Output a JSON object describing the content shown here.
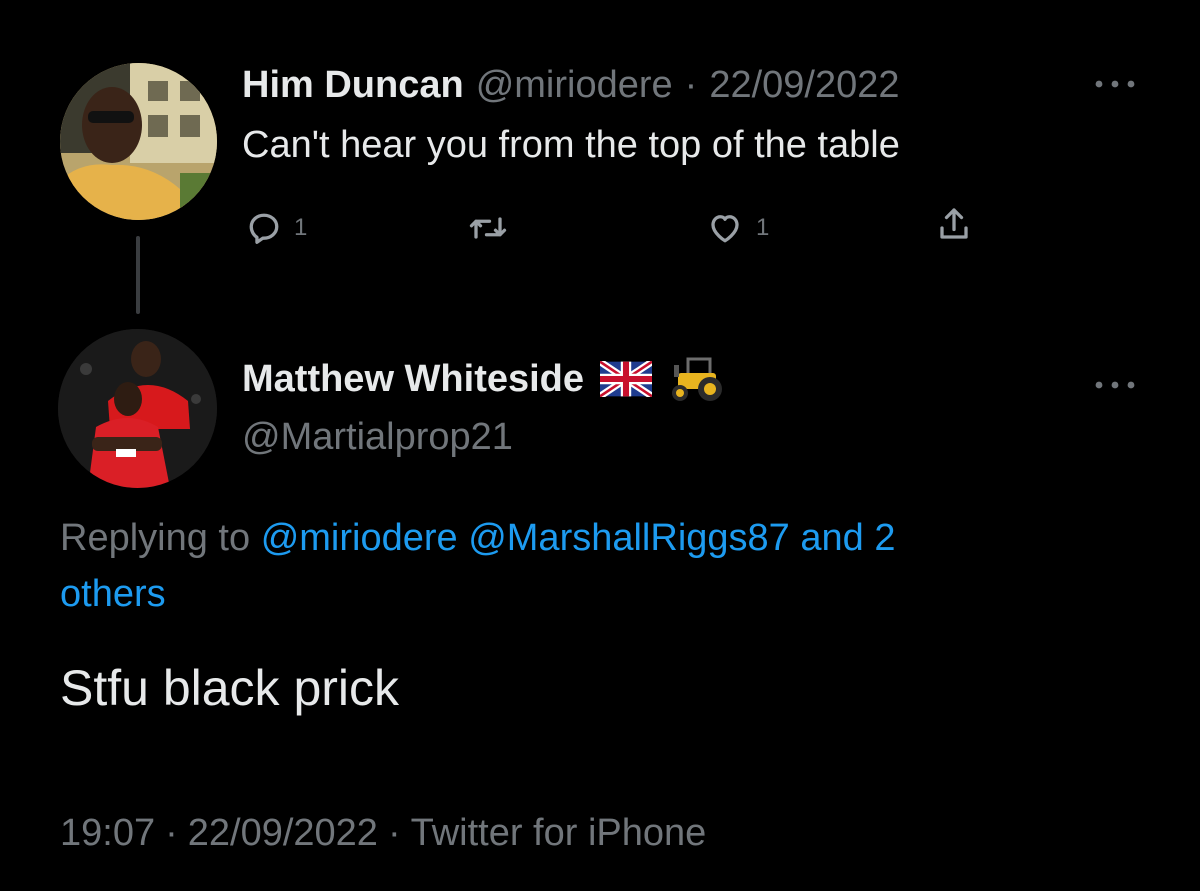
{
  "parent_tweet": {
    "display_name": "Him Duncan",
    "handle": "@miriodere",
    "separator": "·",
    "date": "22/09/2022",
    "text": "Can't hear you from the top of the table",
    "more_icon": "more-dots-icon",
    "actions": {
      "reply": {
        "icon": "reply-icon",
        "count": "1"
      },
      "retweet": {
        "icon": "retweet-icon",
        "count": ""
      },
      "like": {
        "icon": "heart-icon",
        "count": "1"
      },
      "share": {
        "icon": "share-icon",
        "count": ""
      }
    }
  },
  "reply_tweet": {
    "display_name": "Matthew Whiteside",
    "name_emojis": [
      "uk-flag-icon",
      "tractor-icon"
    ],
    "handle": "@Martialprop21",
    "replying_prefix": "Replying to",
    "replying_targets": "@miriodere @MarshallRiggs87",
    "replying_and": "and 2",
    "replying_others": "others",
    "text": "Stfu black prick",
    "time": "19:07",
    "separator": "·",
    "date": "22/09/2022",
    "source": "Twitter for iPhone",
    "more_icon": "more-dots-icon"
  },
  "colors": {
    "background": "#000000",
    "text": "#e7e9ea",
    "muted": "#71767b",
    "link": "#1d9bf0"
  }
}
